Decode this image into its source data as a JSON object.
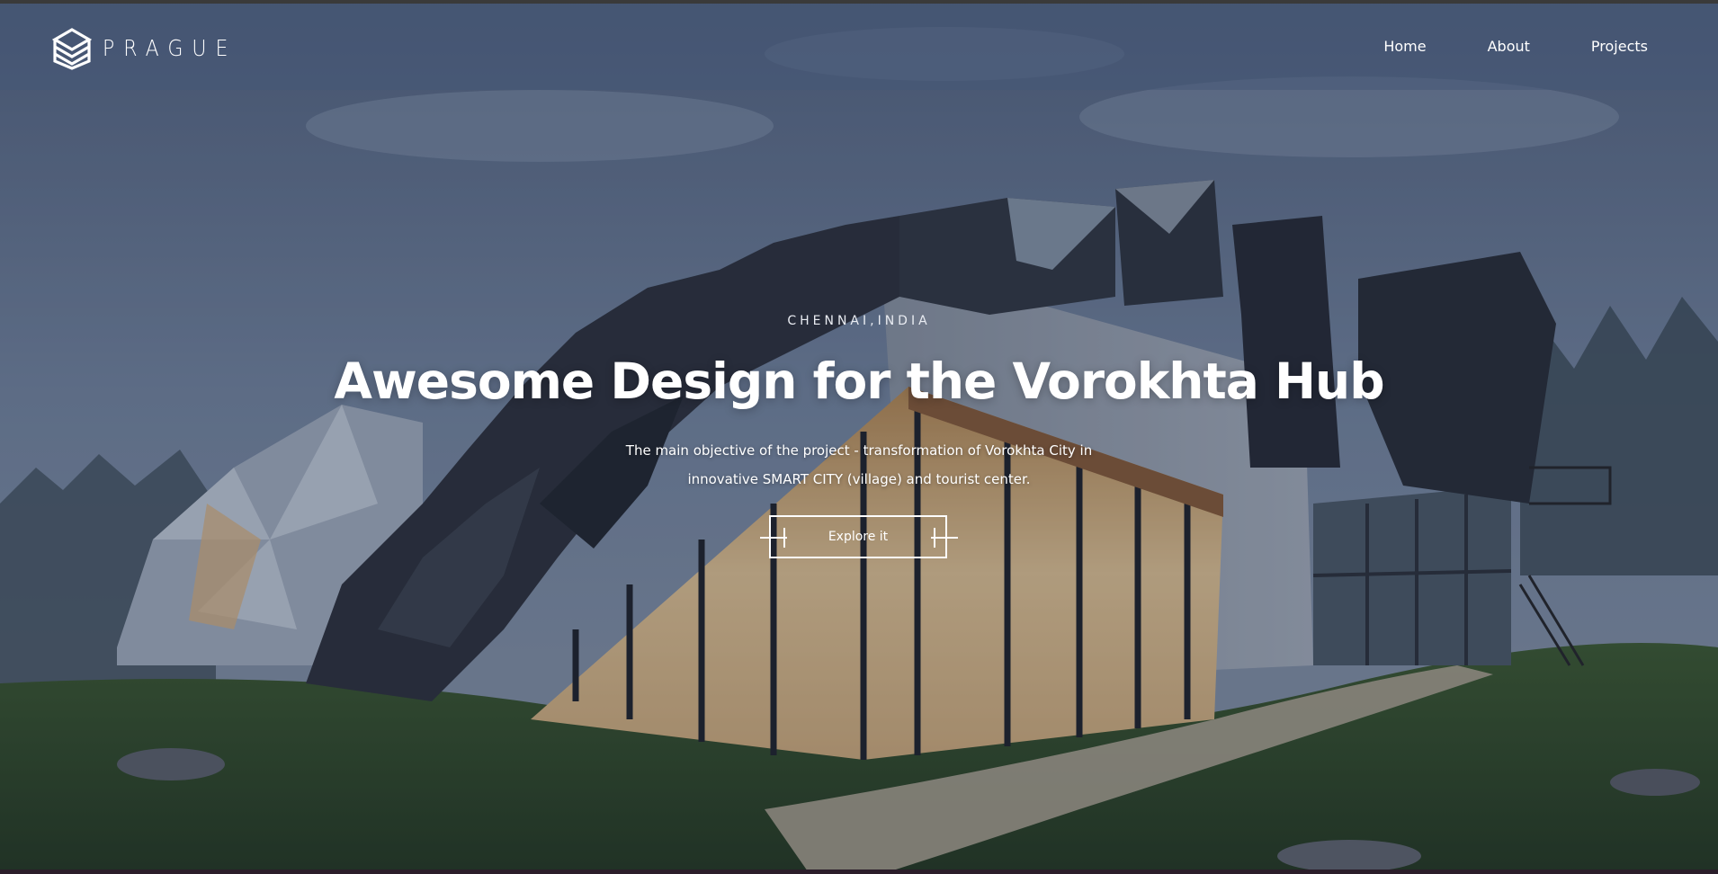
{
  "header": {
    "logo_text": "PRAGUE",
    "nav": [
      {
        "label": "Home"
      },
      {
        "label": "About"
      },
      {
        "label": "Projects"
      }
    ]
  },
  "hero": {
    "location": "CHENNAI,INDIA",
    "headline": "Awesome Design for the Vorokhta Hub",
    "subtitle": "The main objective of the project - transformation of Vorokhta City in innovative SMART CITY (village) and tourist center.",
    "cta_label": "Explore it"
  },
  "colors": {
    "text": "#ffffff",
    "header_bg": "#465876",
    "sky": "#6b7c97",
    "grass": "#2f4a22"
  },
  "icons": {
    "logo_mark": "stacked-diamond-logo-icon"
  }
}
